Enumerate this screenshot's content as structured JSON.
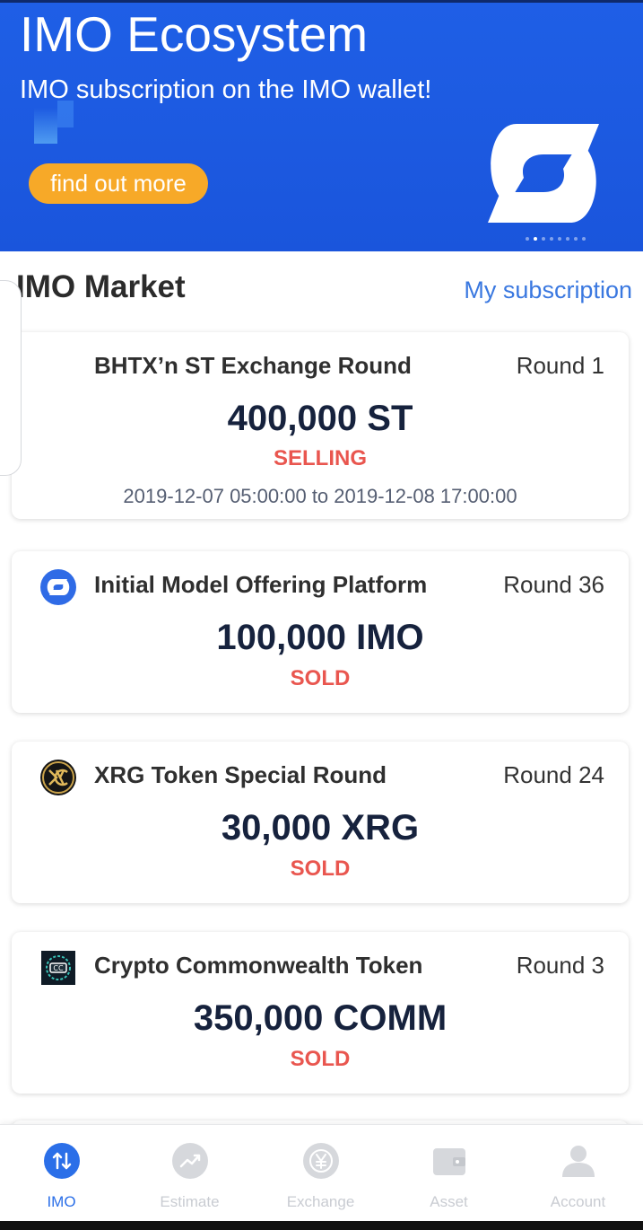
{
  "banner": {
    "title": "IMO Ecosystem",
    "subtitle": "IMO subscription on the IMO wallet!",
    "button_label": "find out more",
    "colors": {
      "background": "#1a55dc",
      "button": "#f7a928"
    },
    "carousel_dots": 8,
    "active_dot": 2
  },
  "market": {
    "title": "IMO Market",
    "my_subscription_label": "My subscription",
    "link_color": "#3a78e0"
  },
  "cards": [
    {
      "name": "BHTX’n ST Exchange Round",
      "round": "Round 1",
      "amount": "400,000 ST",
      "status": "SELLING",
      "period": "2019-12-07 05:00:00 to 2019-12-08 17:00:00",
      "icon": "none"
    },
    {
      "name": "Initial Model Offering Platform",
      "round": "Round 36",
      "amount": "100,000 IMO",
      "status": "SOLD",
      "icon": "imo-logo-icon"
    },
    {
      "name": "XRG Token Special Round",
      "round": "Round 24",
      "amount": "30,000 XRG",
      "status": "SOLD",
      "icon": "xrg-logo-icon"
    },
    {
      "name": "Crypto Commonwealth Token",
      "round": "Round 3",
      "amount": "350,000 COMM",
      "status": "SOLD",
      "icon": "comm-logo-icon"
    }
  ],
  "status_color": "#e9564f",
  "nav": {
    "active_color": "#2b6fe8",
    "inactive_color": "#c9ccd2",
    "items": [
      {
        "label": "IMO",
        "icon": "imo-arrows-icon",
        "active": true
      },
      {
        "label": "Estimate",
        "icon": "trend-icon",
        "active": false
      },
      {
        "label": "Exchange",
        "icon": "yen-coin-icon",
        "active": false
      },
      {
        "label": "Asset",
        "icon": "wallet-icon",
        "active": false
      },
      {
        "label": "Account",
        "icon": "person-icon",
        "active": false
      }
    ]
  }
}
